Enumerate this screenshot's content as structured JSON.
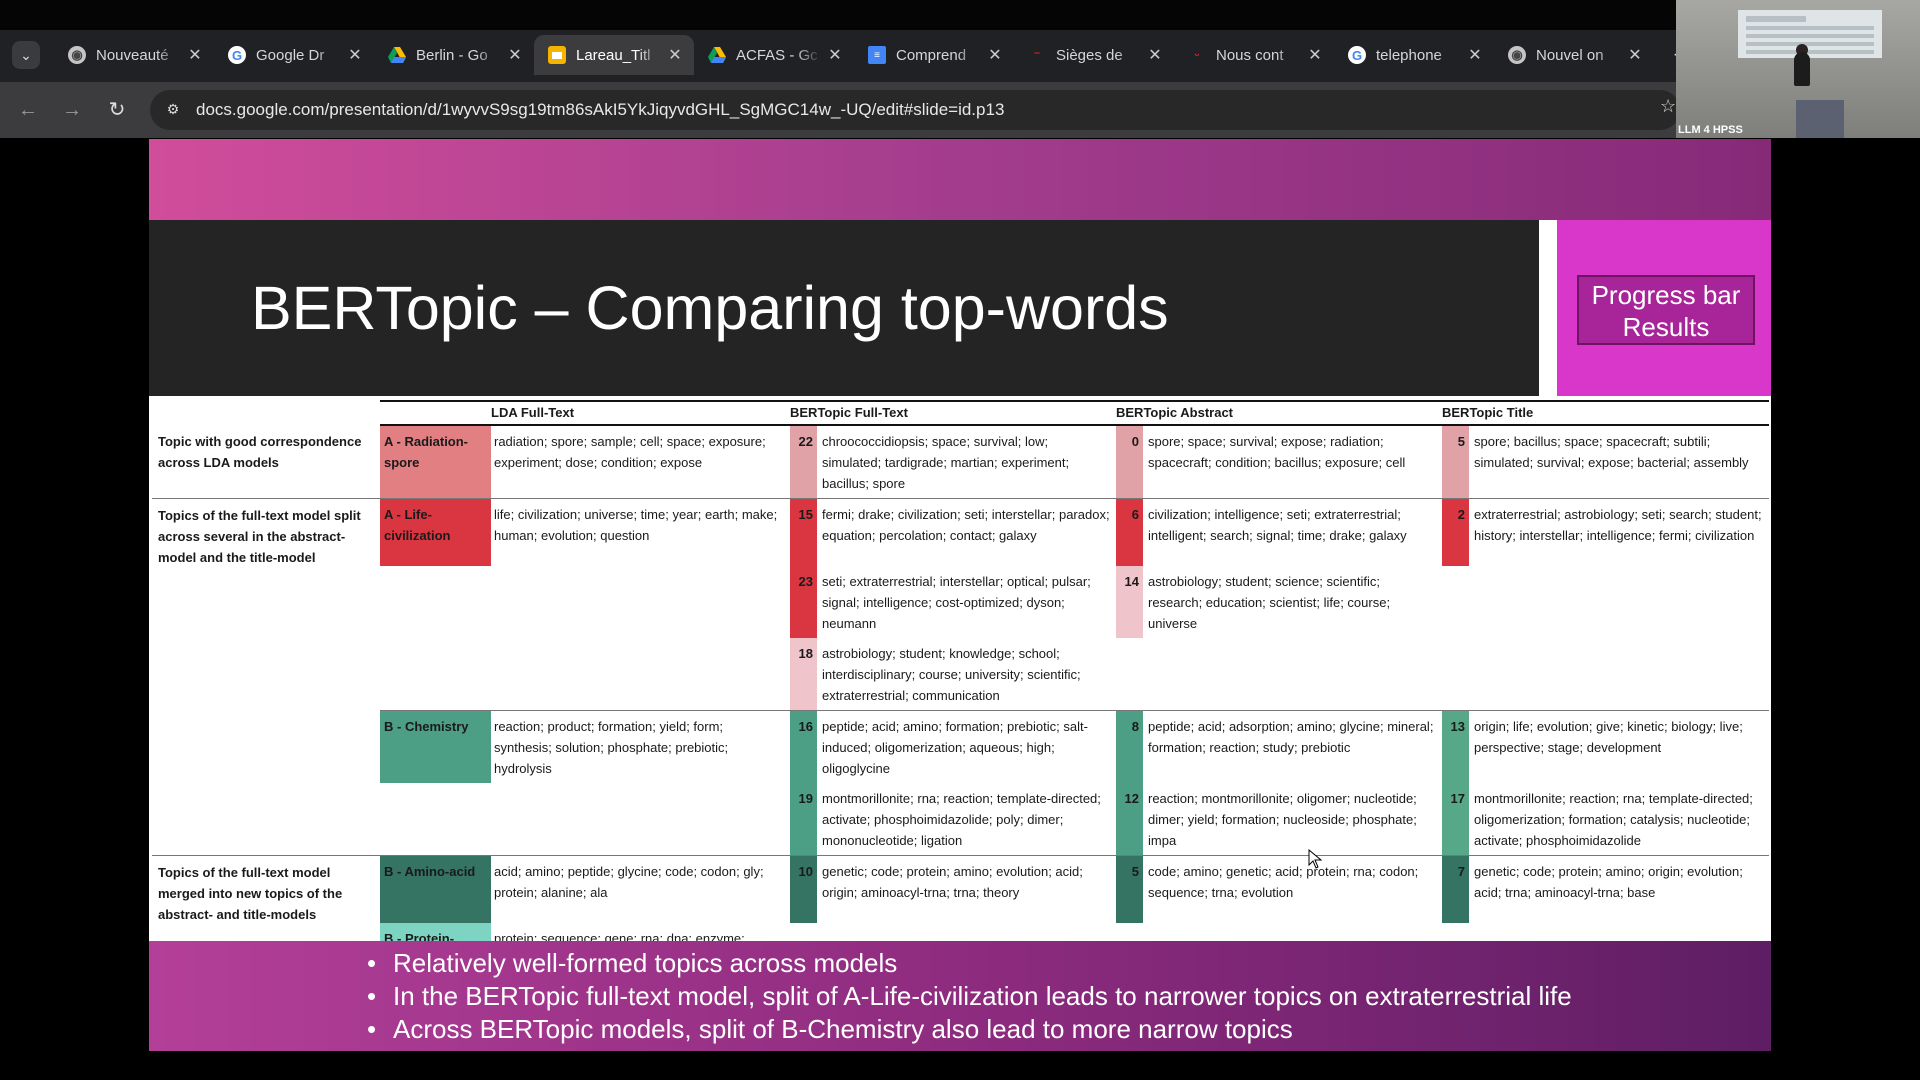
{
  "browser": {
    "tabs": [
      {
        "title": "Nouveauté",
        "icon": "chrome-icon",
        "active": false
      },
      {
        "title": "Google Dr",
        "icon": "google-icon",
        "active": false
      },
      {
        "title": "Berlin - Go",
        "icon": "drive-icon",
        "active": false
      },
      {
        "title": "Lareau_Titl",
        "icon": "slides-icon",
        "active": true
      },
      {
        "title": "ACFAS - Gc",
        "icon": "drive-icon",
        "active": false
      },
      {
        "title": "Comprend",
        "icon": "docs-icon",
        "active": false
      },
      {
        "title": "Sièges de",
        "icon": "site-icon",
        "active": false
      },
      {
        "title": "Nous cont",
        "icon": "site-icon",
        "active": false
      },
      {
        "title": "telephone",
        "icon": "google-icon",
        "active": false
      },
      {
        "title": "Nouvel on",
        "icon": "chrome-icon",
        "active": false
      }
    ],
    "url": "docs.google.com/presentation/d/1wyvvS9sg19tm86sAkI5YkJiqyvdGHL_SgMGC14w_-UQ/edit#slide=id.p13"
  },
  "webcam": {
    "label": "LLM 4 HPSS"
  },
  "slide": {
    "title": "BERTopic – Comparing top-words",
    "side_box": {
      "line1": "Progress bar",
      "line2": "Results"
    },
    "headers": [
      "LDA Full-Text",
      "BERTopic Full-Text",
      "BERTopic Abstract",
      "BERTopic Title"
    ],
    "sections": {
      "s1": "Topic with good correspondence across LDA models",
      "s2": "Topics of the full-text model split across several in the abstract-model and the title-model",
      "s3": "Topics of the full-text model merged into new topics of the abstract- and title-models"
    },
    "rows": {
      "rad": {
        "label": "A - Radiation-spore",
        "lda": "radiation; spore; sample; cell; space; exposure; experiment; dose; condition; expose",
        "ft_n": "22",
        "ft": "chroococcidiopsis; space; survival; low; simulated; tardigrade; martian; experiment; bacillus; spore",
        "ab_n": "0",
        "ab": "spore; space; survival; expose; radiation; spacecraft; condition; bacillus; exposure; cell",
        "ti_n": "5",
        "ti": "spore; bacillus; space; spacecraft; subtili; simulated; survival; expose; bacterial; assembly"
      },
      "life": {
        "label": "A - Life-civilization",
        "lda": "life; civilization; universe; time; year; earth; make; human; evolution; question",
        "ft_n": "15",
        "ft": "fermi; drake; civilization; seti; interstellar; paradox; equation; percolation; contact; galaxy",
        "ab_n": "6",
        "ab": "civilization; intelligence; seti; extraterrestrial; intelligent; search; signal; time; drake; galaxy",
        "ti_n": "2",
        "ti": "extraterrestrial; astrobiology; seti; search; student; history; interstellar; intelligence; fermi; civilization"
      },
      "life2": {
        "ft_n": "23",
        "ft": "seti; extraterrestrial; interstellar; optical; pulsar; signal; intelligence; cost-optimized; dyson; neumann",
        "ab_n": "14",
        "ab": "astrobiology; student; science; scientific; research; education; scientist; life; course; universe"
      },
      "life3": {
        "ft_n": "18",
        "ft": "astrobiology; student; knowledge; school; interdisciplinary; course; university; scientific; extraterrestrial; communication"
      },
      "chem": {
        "label": "B - Chemistry",
        "lda": "reaction; product; formation; yield; form; synthesis; solution; phosphate; prebiotic; hydrolysis",
        "ft_n": "16",
        "ft": "peptide; acid; amino; formation; prebiotic; salt-induced; oligomerization; aqueous; high; oligoglycine",
        "ab_n": "8",
        "ab": "peptide; acid; adsorption; amino; glycine; mineral; formation; reaction; study; prebiotic",
        "ti_n": "13",
        "ti": "origin; life; evolution; give; kinetic; biology; live; perspective; stage; development"
      },
      "chem2": {
        "ft_n": "19",
        "ft": "montmorillonite; rna; reaction; template-directed; activate; phosphoimidazolide; poly; dimer; mononucleotide; ligation",
        "ab_n": "12",
        "ab": "reaction; montmorillonite; oligomer; nucleotide; dimer; yield; formation; nucleoside; phosphate; impa",
        "ti_n": "17",
        "ti": "montmorillonite; reaction; rna; template-directed; oligomerization; formation; catalysis; nucleotide; activate; phosphoimidazolide"
      },
      "amino": {
        "label": "B - Amino-acid",
        "lda": "acid; amino; peptide; glycine; code; codon; gly; protein; alanine; ala",
        "ft_n": "10",
        "ft": "genetic; code; protein; amino; evolution; acid; origin; aminoacyl-trna; trna; theory",
        "ab_n": "5",
        "ab": "code; amino; genetic; acid; protein; rna; codon; sequence; trna; evolution",
        "ti_n": "7",
        "ti": "genetic; code; protein; amino; origin; evolution; acid; trna; aminoacyl-trna; base"
      },
      "prot": {
        "label": "B - Protein-gene-RNA",
        "lda": "protein; sequence; gene; rna; dna; enzyme; structure; group; organism; genetic"
      }
    },
    "bullets": [
      "Relatively well-formed topics across models",
      "In the BERTopic full-text model, split of A-Life-civilization leads to narrower topics on extraterrestrial life",
      "Across BERTopic models, split of B-Chemistry also lead to more narrow topics"
    ]
  }
}
